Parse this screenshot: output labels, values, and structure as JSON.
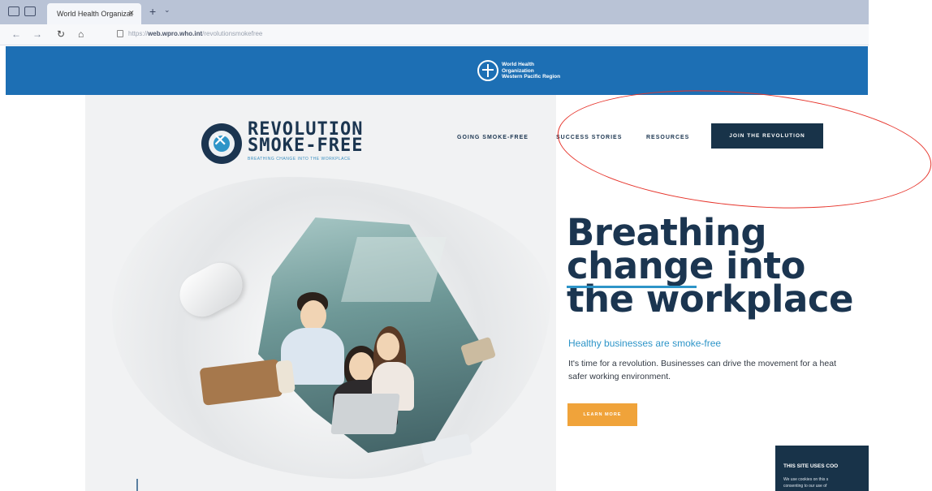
{
  "browser": {
    "tab_title": "World Health Organizat",
    "tab_close_icon": "close-icon",
    "new_tab_glyph": "+",
    "more_tabs_glyph": "⌄",
    "url_prefix": "https://",
    "url_host": "web.wpro.who.int",
    "url_path": "/revolutionsmokefree",
    "nav_icons": [
      "back-icon",
      "forward-icon",
      "refresh-icon",
      "home-icon"
    ]
  },
  "banner": {
    "org_line1": "World Health",
    "org_line2": "Organization",
    "org_line3": "Western Pacific Region"
  },
  "brand": {
    "line1": "REVOLUTION",
    "line2": "SMOKE-FREE",
    "tagline": "BREATHING CHANGE INTO THE WORKPLACE",
    "mark_glyph": "✕"
  },
  "nav": {
    "going": "GOING SMOKE-FREE",
    "success": "SUCCESS STORIES",
    "resources": "RESOURCES",
    "join": "JOIN THE REVOLUTION"
  },
  "hero": {
    "title_line1": "Breathing",
    "title_line2": "change into",
    "title_line3": "the workplace",
    "subtitle": "Healthy businesses are smoke-free",
    "body_line1": "It's time for a revolution. Businesses can drive the movement for a heat",
    "body_line2": "safer working environment.",
    "learn_more": "LEARN MORE"
  },
  "cookie": {
    "title": "THIS SITE USES COO",
    "line1": "We use cookies on this s",
    "line2": "consenting to our use of"
  },
  "colors": {
    "brand_navy": "#183349",
    "who_blue": "#1d6fb4",
    "accent_blue": "#2e95c8",
    "learn_orange": "#f0a33a",
    "annotation_red": "#e6332a"
  }
}
